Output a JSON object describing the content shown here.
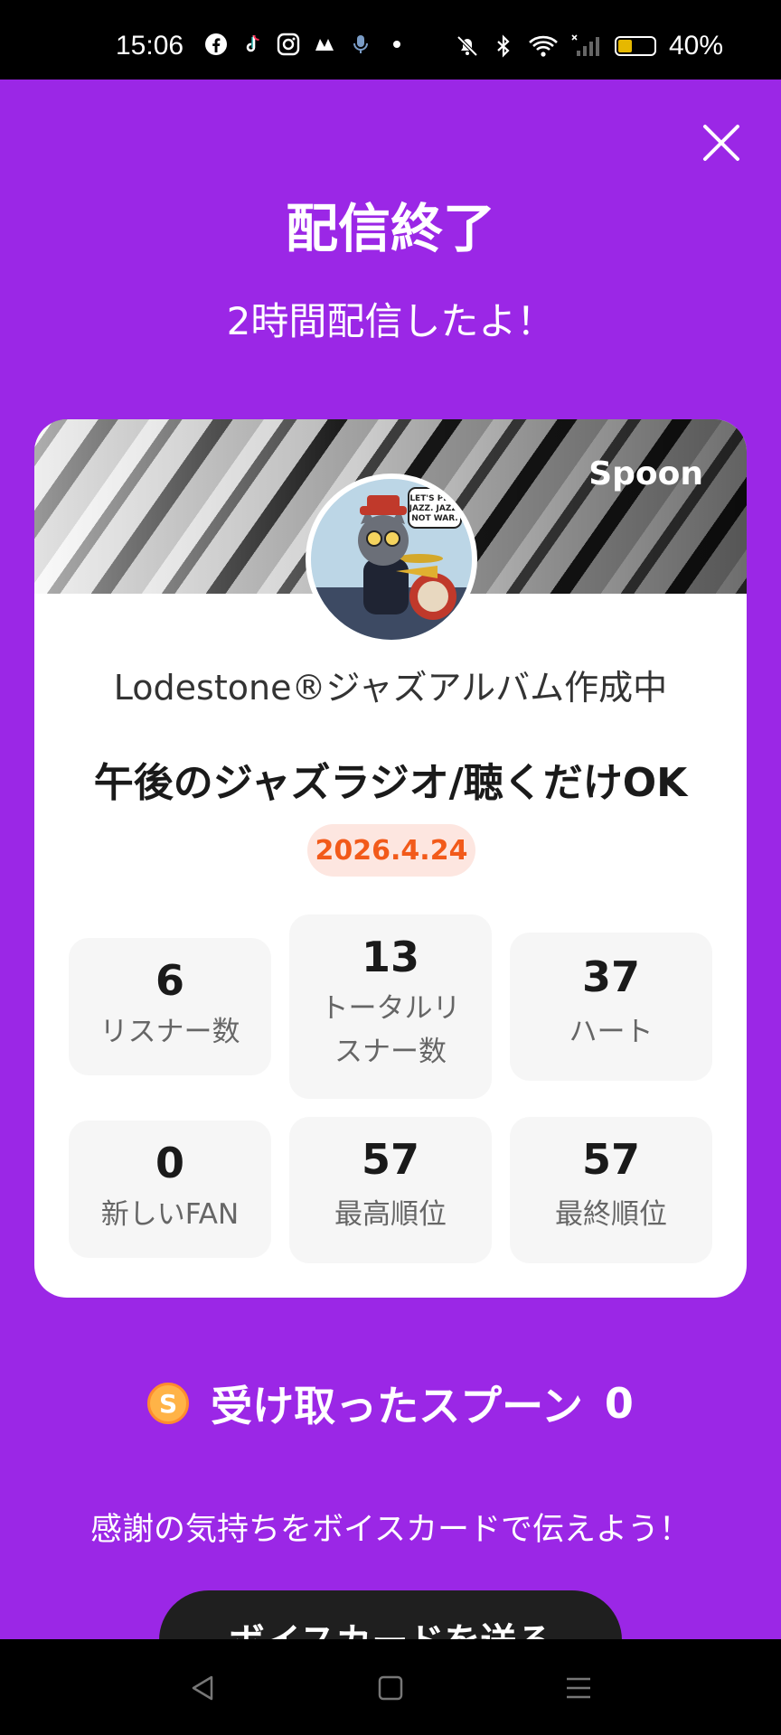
{
  "status_bar": {
    "time": "15:06",
    "battery_percent": "40%",
    "battery_level": 0.4,
    "left_icons": [
      "facebook-icon",
      "tiktok-icon",
      "instagram-icon",
      "app-icon",
      "mic-icon",
      "dot-icon"
    ],
    "right_icons": [
      "mute-icon",
      "bluetooth-icon",
      "wifi-icon",
      "signal-icon",
      "battery-icon"
    ]
  },
  "header": {
    "title": "配信終了",
    "subtitle": "2時間配信したよ！",
    "close_icon": "close-icon"
  },
  "card": {
    "brand": "Spoon",
    "avatar_text": "LET'S PLAY JAZZ. JAZZ. NOT WAR.",
    "host_name": "Lodestone®ジャズアルバム作成中",
    "stream_title": "午後のジャズラジオ/聴くだけOK",
    "date": "2026.4.24",
    "stats": [
      {
        "value": "6",
        "label": "リスナー数"
      },
      {
        "value": "13",
        "label": "トータルリスナー数"
      },
      {
        "value": "37",
        "label": "ハート"
      },
      {
        "value": "0",
        "label": "新しいFAN"
      },
      {
        "value": "57",
        "label": "最高順位"
      },
      {
        "value": "57",
        "label": "最終順位"
      }
    ]
  },
  "spoons": {
    "label": "受け取ったスプーン",
    "count": "0",
    "coin_symbol": "S"
  },
  "thanks_text": "感謝の気持ちをボイスカードで伝えよう！",
  "voice_card_button": "ボイスカードを送る",
  "colors": {
    "background": "#9b27e6",
    "date_text": "#f25a1a",
    "date_bg": "#fde6e0"
  },
  "nav_bar": [
    "back-icon",
    "home-icon",
    "menu-icon"
  ]
}
